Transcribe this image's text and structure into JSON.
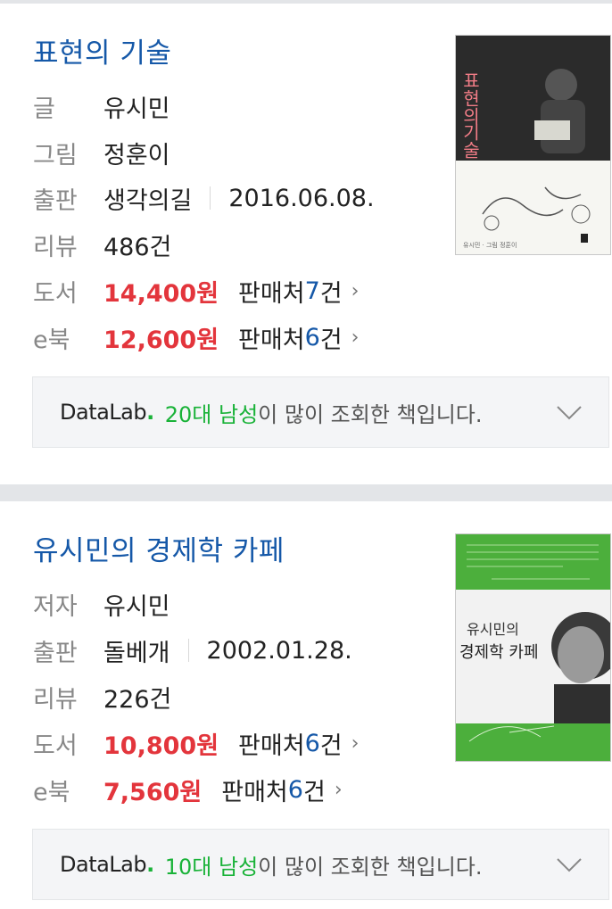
{
  "books": [
    {
      "title": "표현의 기술",
      "rows": [
        {
          "label": "글",
          "value": "유시민"
        },
        {
          "label": "그림",
          "value": "정훈이"
        },
        {
          "label": "출판",
          "value": "생각의길",
          "date": "2016.06.08."
        },
        {
          "label": "리뷰",
          "value": "486건"
        }
      ],
      "prices": [
        {
          "label": "도서",
          "price": "14,400원",
          "seller": "판매처 ",
          "count": "7",
          "suffix": "건"
        },
        {
          "label": "e북",
          "price": "12,600원",
          "seller": "판매처 ",
          "count": "6",
          "suffix": "건"
        }
      ],
      "cover": {
        "title_line1": "표현의",
        "title_line2": "기술",
        "footer": "유시민 · 그림 정훈이"
      },
      "datalab": {
        "logo": "DataLab",
        "dot": ".",
        "highlight": "20대 남성",
        "rest": "이 많이 조회한 책입니다."
      }
    },
    {
      "title": "유시민의 경제학 카페",
      "rows": [
        {
          "label": "저자",
          "value": "유시민"
        },
        {
          "label": "출판",
          "value": "돌베개",
          "date": "2002.01.28."
        },
        {
          "label": "리뷰",
          "value": "226건"
        }
      ],
      "prices": [
        {
          "label": "도서",
          "price": "10,800원",
          "seller": "판매처 ",
          "count": "6",
          "suffix": "건"
        },
        {
          "label": "e북",
          "price": "7,560원",
          "seller": "판매처 ",
          "count": "6",
          "suffix": "건"
        }
      ],
      "cover": {
        "title_line1": "유시민의",
        "title_line2": "경제학 카페"
      },
      "datalab": {
        "logo": "DataLab",
        "dot": ".",
        "highlight": "10대 남성",
        "rest": "이 많이 조회한 책입니다."
      }
    }
  ],
  "colors": {
    "title": "#1558a8",
    "price": "#e3353c",
    "count": "#1558a8",
    "datalab_green": "#19b238",
    "cover2_green": "#4caf3c"
  },
  "icons": {
    "chevron_right": "chevron-right-icon",
    "chevron_down": "chevron-down-icon"
  }
}
